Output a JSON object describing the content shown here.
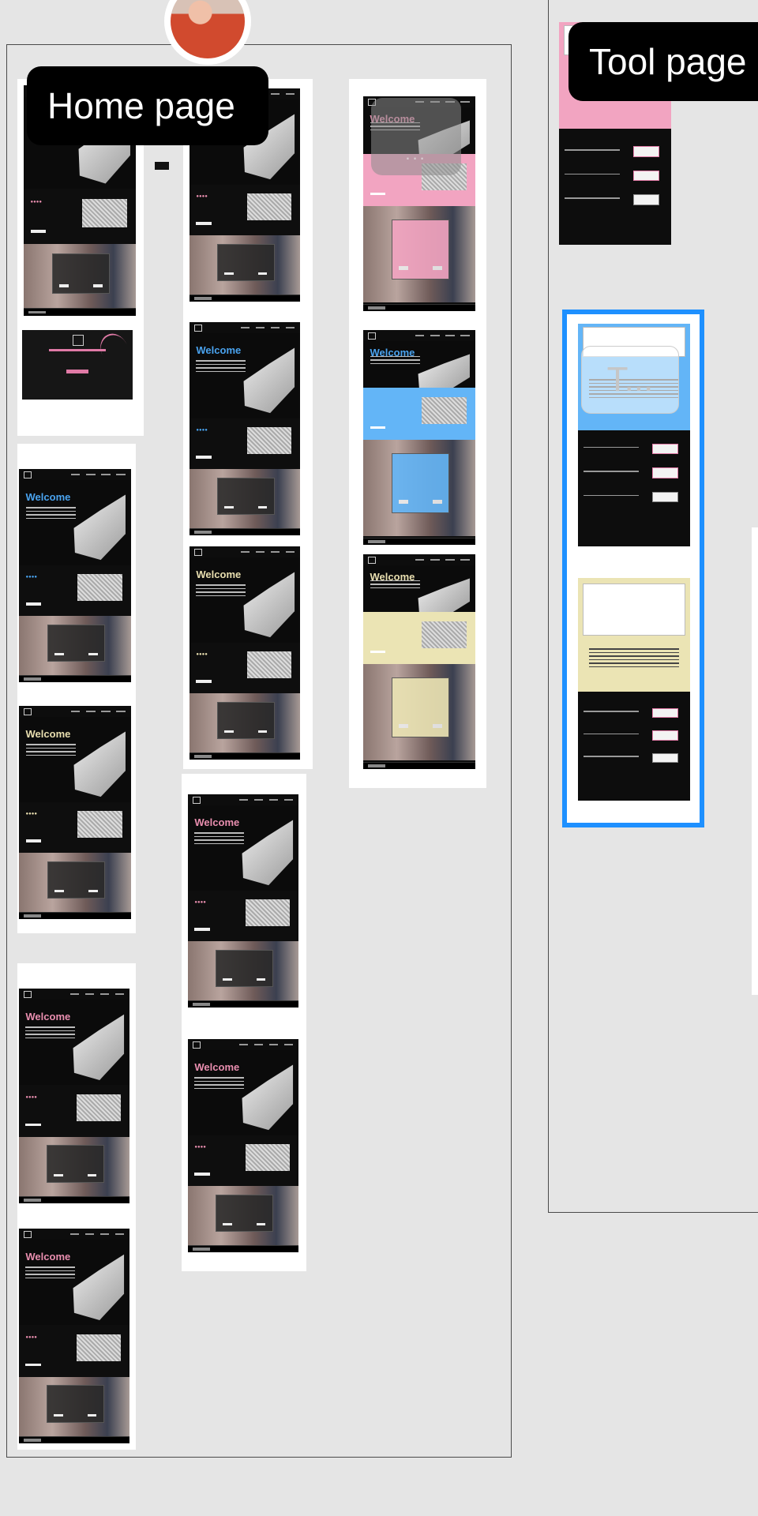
{
  "canvas": {
    "background": "#e5e5e5",
    "sections": [
      {
        "name": "home",
        "label": "Home page"
      },
      {
        "name": "tool",
        "label": "Tool page"
      }
    ]
  },
  "screens": {
    "welcome_heading": "Welcome",
    "themes": {
      "pink": "#ea8fb0",
      "blue": "#4aa3ef",
      "cream": "#e9dfb0",
      "pink_bg": "#f2a4c1",
      "blue_bg": "#63b5f7",
      "cream_bg": "#ebe4b4"
    }
  },
  "text_tool_hint": "T...",
  "drag_hint": "...",
  "selection_color": "#1e90ff"
}
